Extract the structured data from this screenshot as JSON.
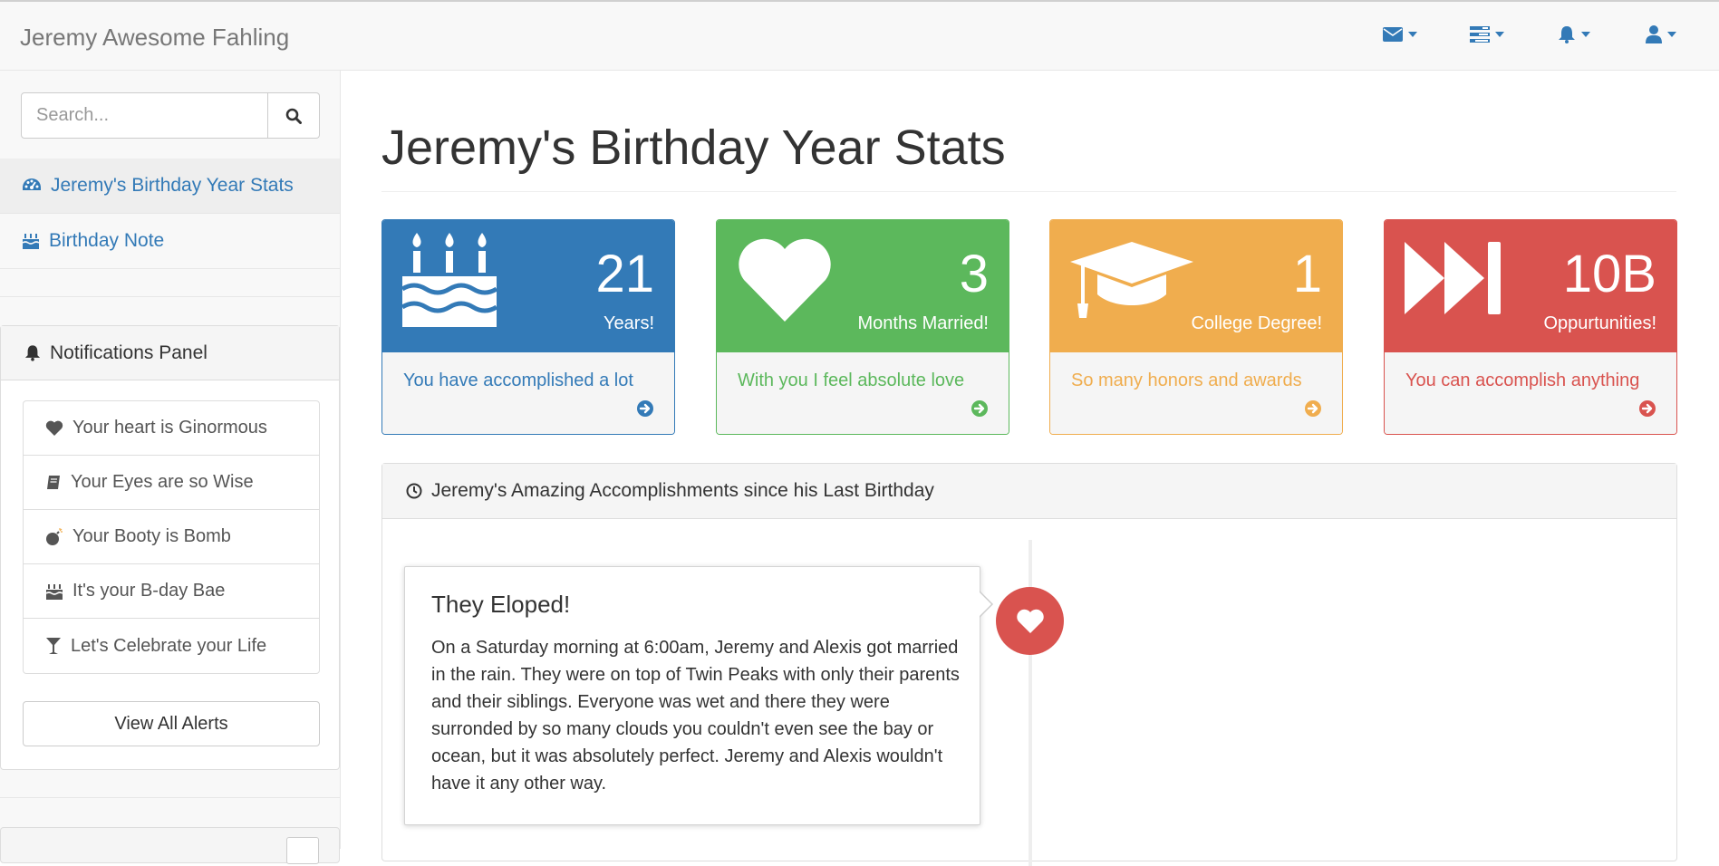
{
  "navbar": {
    "brand": "Jeremy Awesome Fahling",
    "menus": [
      {
        "icon": "envelope-icon"
      },
      {
        "icon": "tasks-icon"
      },
      {
        "icon": "bell-icon"
      },
      {
        "icon": "user-icon"
      }
    ],
    "accent": "#337ab7"
  },
  "sidebar": {
    "search": {
      "placeholder": "Search...",
      "value": ""
    },
    "nav": [
      {
        "label": "Jeremy's Birthday Year Stats",
        "icon": "dashboard-icon",
        "active": true
      },
      {
        "label": "Birthday Note",
        "icon": "birthday-cake-icon",
        "active": false
      }
    ],
    "notifications": {
      "title": "Notifications Panel",
      "items": [
        {
          "label": "Your heart is Ginormous",
          "icon": "heart-icon"
        },
        {
          "label": "Your Eyes are so Wise",
          "icon": "book-icon"
        },
        {
          "label": "Your Booty is Bomb",
          "icon": "bomb-icon"
        },
        {
          "label": "It's your B-day Bae",
          "icon": "birthday-cake-icon"
        },
        {
          "label": "Let's Celebrate your Life",
          "icon": "glass-icon"
        }
      ],
      "view_all": "View All Alerts"
    }
  },
  "main": {
    "title": "Jeremy's Birthday Year Stats",
    "cards": [
      {
        "value": "21",
        "label": "Years!",
        "footer": "You have accomplished a lot",
        "icon": "birthday-cake-icon",
        "color": "#337ab7"
      },
      {
        "value": "3",
        "label": "Months Married!",
        "footer": "With you I feel absolute love",
        "icon": "heart-icon",
        "color": "#5cb85c"
      },
      {
        "value": "1",
        "label": "College Degree!",
        "footer": "So many honors and awards",
        "icon": "graduation-cap-icon",
        "color": "#f0ad4e"
      },
      {
        "value": "10B",
        "label": "Oppurtunities!",
        "footer": "You can accomplish anything",
        "icon": "fast-forward-icon",
        "color": "#d9534f"
      }
    ],
    "timeline": {
      "title": "Jeremy's Amazing Accomplishments since his Last Birthday",
      "entries": [
        {
          "heading": "They Eloped!",
          "body": "On a Saturday morning at 6:00am, Jeremy and Alexis got married in the rain. They were on top of Twin Peaks with only their parents and their siblings. Everyone was wet and there they were surronded by so many clouds you couldn't even see the bay or ocean, but it was absolutely perfect. Jeremy and Alexis wouldn't have it any other way.",
          "badge_icon": "heart-icon",
          "badge_color": "#d9534f"
        }
      ]
    }
  }
}
